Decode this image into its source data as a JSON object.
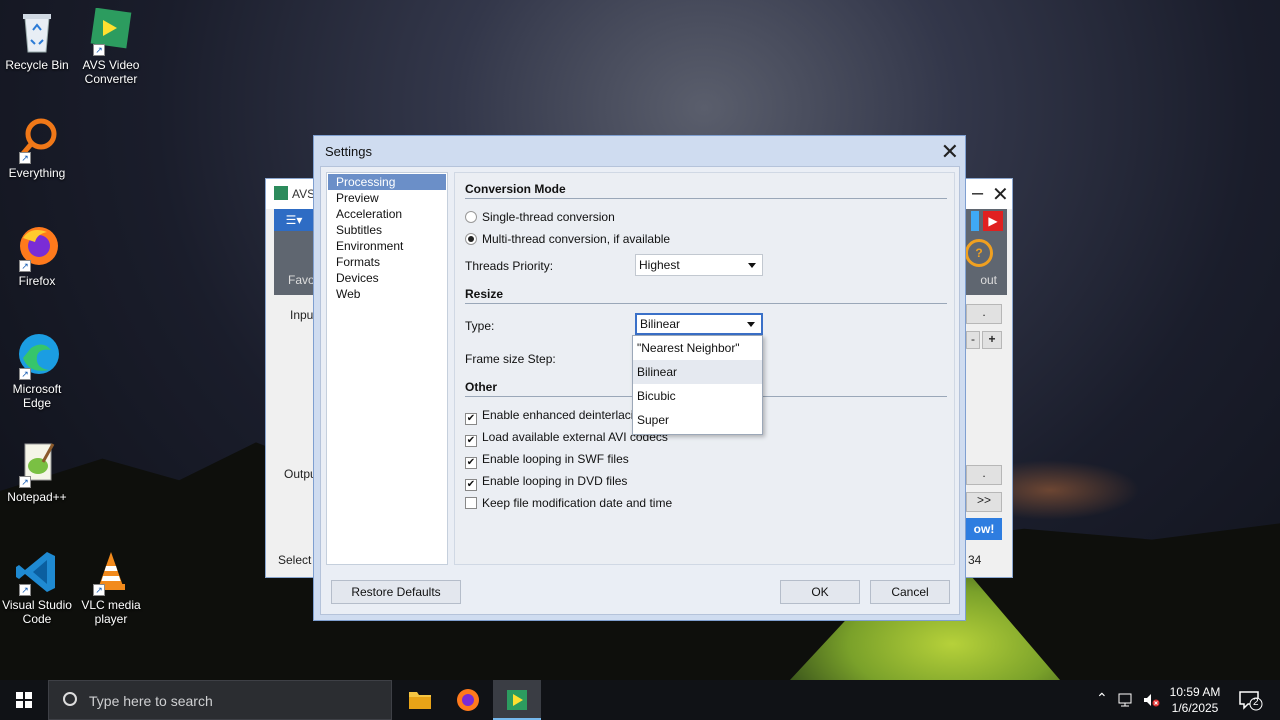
{
  "desktop": {
    "icons": [
      {
        "label": "Recycle Bin",
        "icon": "recycle-bin-icon"
      },
      {
        "label": "AVS Video Converter",
        "icon": "avs-icon"
      },
      {
        "label": "Everything",
        "icon": "everything-icon"
      },
      {
        "label": "Firefox",
        "icon": "firefox-icon"
      },
      {
        "label": "Microsoft Edge",
        "icon": "edge-icon"
      },
      {
        "label": "Notepad++",
        "icon": "notepadpp-icon"
      },
      {
        "label": "Visual Studio Code",
        "icon": "vscode-icon"
      },
      {
        "label": "VLC media player",
        "icon": "vlc-icon"
      }
    ]
  },
  "avs_window": {
    "title": "AVS",
    "left_label": "Favo",
    "right_label": "out",
    "input_label": "Inpu",
    "output_label": "Outpu",
    "status_text": "Select",
    "status_number": "34",
    "button_dots_1": ".",
    "button_dots_2": ".",
    "button_next": ">>",
    "button_now": "ow!",
    "button_plus": "+",
    "button_minus": "-"
  },
  "settings": {
    "title": "Settings",
    "nav": [
      "Processing",
      "Preview",
      "Acceleration",
      "Subtitles",
      "Environment",
      "Formats",
      "Devices",
      "Web"
    ],
    "selected_nav": "Processing",
    "conversion_mode": {
      "heading": "Conversion Mode",
      "single": "Single-thread conversion",
      "multi": "Multi-thread conversion, if available",
      "selected": "multi"
    },
    "threads_priority": {
      "label": "Threads Priority:",
      "value": "Highest"
    },
    "resize": {
      "heading": "Resize",
      "type_label": "Type:",
      "type_value": "Bilinear",
      "frame_size_label": "Frame size Step:",
      "options": [
        "\"Nearest Neighbor\"",
        "Bilinear",
        "Bicubic",
        "Super"
      ],
      "highlighted": "Bilinear"
    },
    "other": {
      "heading": "Other",
      "items": [
        {
          "label": "Enable enhanced deinterlacing m",
          "checked": true
        },
        {
          "label": "Load available external AVI codecs",
          "checked": true
        },
        {
          "label": "Enable looping in SWF files",
          "checked": true
        },
        {
          "label": "Enable looping in DVD files",
          "checked": true
        },
        {
          "label": "Keep file modification date and time",
          "checked": false
        }
      ]
    },
    "buttons": {
      "restore": "Restore Defaults",
      "ok": "OK",
      "cancel": "Cancel"
    }
  },
  "taskbar": {
    "search_placeholder": "Type here to search",
    "time": "10:59 AM",
    "date": "1/6/2025",
    "notification_count": "2"
  }
}
